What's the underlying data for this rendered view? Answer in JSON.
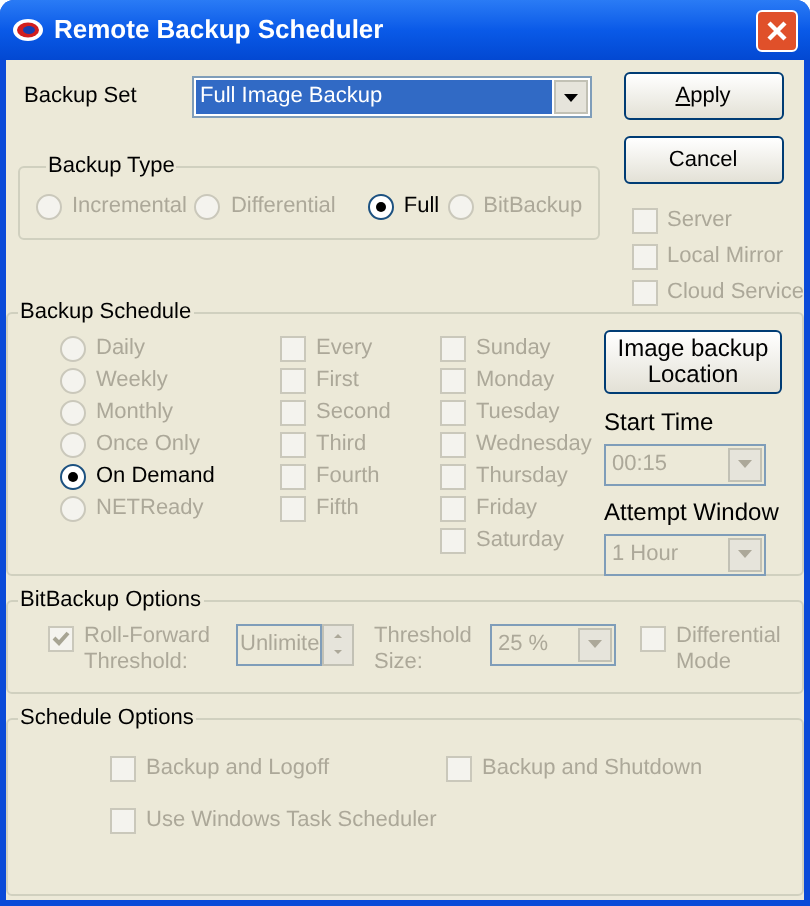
{
  "window": {
    "title": "Remote Backup Scheduler"
  },
  "backup_set": {
    "label": "Backup Set",
    "value": "Full Image Backup",
    "highlighted": true
  },
  "buttons": [
    {
      "label": "Apply",
      "underline_first": true
    },
    {
      "label": "Cancel",
      "underline_first": false
    }
  ],
  "backup_type": {
    "title": "Backup Type",
    "options": [
      {
        "label": "Incremental",
        "selected": false,
        "disabled": true
      },
      {
        "label": "Differential",
        "selected": false,
        "disabled": true
      },
      {
        "label": "Full",
        "selected": true,
        "disabled": false
      },
      {
        "label": "BitBackup",
        "selected": false,
        "disabled": true
      }
    ]
  },
  "destinations": [
    {
      "label": "Server",
      "checked": false,
      "disabled": true
    },
    {
      "label": "Local Mirror",
      "checked": false,
      "disabled": true
    },
    {
      "label": "Cloud Service",
      "checked": false,
      "disabled": true
    }
  ],
  "backup_schedule": {
    "title": "Backup Schedule",
    "frequencies": [
      {
        "label": "Daily",
        "selected": false,
        "disabled": true
      },
      {
        "label": "Weekly",
        "selected": false,
        "disabled": true
      },
      {
        "label": "Monthly",
        "selected": false,
        "disabled": true
      },
      {
        "label": "Once Only",
        "selected": false,
        "disabled": true
      },
      {
        "label": "On Demand",
        "selected": true,
        "disabled": false
      },
      {
        "label": "NETReady",
        "selected": false,
        "disabled": true
      }
    ],
    "occurrences": [
      {
        "label": "Every",
        "checked": false,
        "disabled": true
      },
      {
        "label": "First",
        "checked": false,
        "disabled": true
      },
      {
        "label": "Second",
        "checked": false,
        "disabled": true
      },
      {
        "label": "Third",
        "checked": false,
        "disabled": true
      },
      {
        "label": "Fourth",
        "checked": false,
        "disabled": true
      },
      {
        "label": "Fifth",
        "checked": false,
        "disabled": true
      }
    ],
    "days": [
      {
        "label": "Sunday",
        "checked": false,
        "disabled": true
      },
      {
        "label": "Monday",
        "checked": false,
        "disabled": true
      },
      {
        "label": "Tuesday",
        "checked": false,
        "disabled": true
      },
      {
        "label": "Wednesday",
        "checked": false,
        "disabled": true
      },
      {
        "label": "Thursday",
        "checked": false,
        "disabled": true
      },
      {
        "label": "Friday",
        "checked": false,
        "disabled": true
      },
      {
        "label": "Saturday",
        "checked": false,
        "disabled": true
      }
    ],
    "location_button": {
      "label": "Image backup Location"
    },
    "start_time": {
      "label": "Start Time",
      "value": "00:15",
      "disabled": true
    },
    "attempt_window": {
      "label": "Attempt Window",
      "value": "1 Hour",
      "disabled": true
    }
  },
  "bitbackup_options": {
    "title": "BitBackup Options",
    "roll_forward": {
      "label": "Roll-Forward Threshold:",
      "checked": true,
      "disabled": true
    },
    "threshold": {
      "value": "Unlimite",
      "disabled": true
    },
    "threshold_size": {
      "label": "Threshold Size:",
      "value": "25 %",
      "disabled": true
    },
    "differential_mode": {
      "label": "Differential Mode",
      "checked": false,
      "disabled": true
    }
  },
  "schedule_options": {
    "title": "Schedule Options",
    "options": [
      {
        "label": "Backup and Logoff",
        "checked": false,
        "disabled": true
      },
      {
        "label": "Backup and Shutdown",
        "checked": false,
        "disabled": true
      },
      {
        "label": "Use Windows Task Scheduler",
        "checked": false,
        "disabled": true
      }
    ]
  }
}
